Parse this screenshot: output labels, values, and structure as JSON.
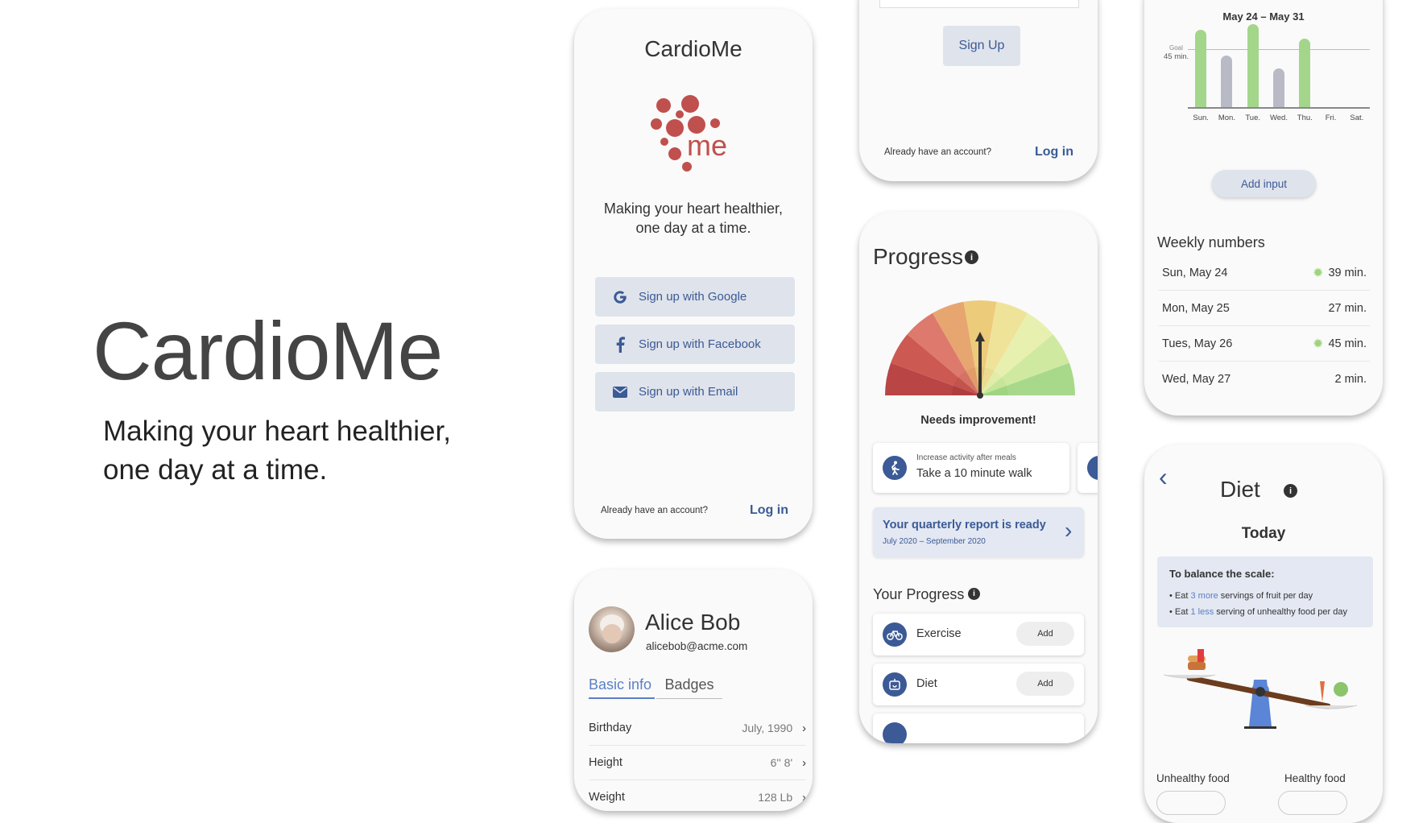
{
  "hero": {
    "title": "CardioMe",
    "tagline_line1": "Making your heart healthier,",
    "tagline_line2": "one day at a time."
  },
  "signup_screen": {
    "app_name": "CardioMe",
    "logo_text": "me",
    "tagline_line1": "Making your heart healthier,",
    "tagline_line2": "one day at a time.",
    "google_label": "Sign up with Google",
    "facebook_label": "Sign up with Facebook",
    "email_label": "Sign up with Email",
    "already_account": "Already have an account?",
    "login_label": "Log in"
  },
  "profile_screen": {
    "name": "Alice Bob",
    "email": "alicebob@acme.com",
    "tabs": [
      {
        "label": "Basic info",
        "active": true
      },
      {
        "label": "Badges",
        "active": false
      }
    ],
    "rows": [
      {
        "label": "Birthday",
        "value": "July, 1990"
      },
      {
        "label": "Height",
        "value": "6'' 8'"
      },
      {
        "label": "Weight",
        "value": "128 Lb"
      }
    ]
  },
  "signup_email_screen": {
    "signup_label": "Sign Up",
    "already_account": "Already have an account?",
    "login_label": "Log in"
  },
  "progress_screen": {
    "title": "Progress",
    "gauge_status": "Needs improvement!",
    "tip_caption": "Increase activity after meals",
    "tip_text": "Take a 10 minute walk",
    "report_title": "Your quarterly report is ready",
    "report_range": "July 2020 – September 2020",
    "your_progress_title": "Your Progress",
    "items": [
      {
        "label": "Exercise",
        "button": "Add"
      },
      {
        "label": "Diet",
        "button": "Add"
      }
    ],
    "colors": {
      "accent": "#3b5a96"
    }
  },
  "activity_screen": {
    "range": "May 24 – May 31",
    "goal_label": "Goal",
    "goal_value": "45 min.",
    "add_input_label": "Add input",
    "weekly_title": "Weekly numbers",
    "weekly": [
      {
        "day": "Sun, May 24",
        "value": "39 min.",
        "sun": true
      },
      {
        "day": "Mon, May 25",
        "value": "27 min.",
        "sun": false
      },
      {
        "day": "Tues, May 26",
        "value": "45 min.",
        "sun": true
      },
      {
        "day": "Wed, May 27",
        "value": "2 min.",
        "sun": false
      }
    ]
  },
  "chart_data": {
    "type": "bar",
    "categories": [
      "Sun.",
      "Mon.",
      "Tue.",
      "Wed.",
      "Thu.",
      "Fri.",
      "Sat."
    ],
    "values": [
      54,
      36,
      58,
      27,
      48,
      0,
      0
    ],
    "goal": 45,
    "ylim": [
      0,
      62
    ],
    "bar_colors": [
      "#a3d68a",
      "#b8bac6",
      "#a3d68a",
      "#b8bac6",
      "#a3d68a",
      "#a3d68a",
      "#a3d68a"
    ]
  },
  "diet_screen": {
    "title": "Diet",
    "today": "Today",
    "balance_title": "To balance the scale:",
    "line1_pre": "Eat ",
    "line1_link": "3 more",
    "line1_post": " servings of fruit per day",
    "line2_pre": "Eat ",
    "line2_link": "1 less",
    "line2_post": " serving of unhealthy food per day",
    "unhealthy_label": "Unhealthy food",
    "healthy_label": "Healthy food"
  }
}
